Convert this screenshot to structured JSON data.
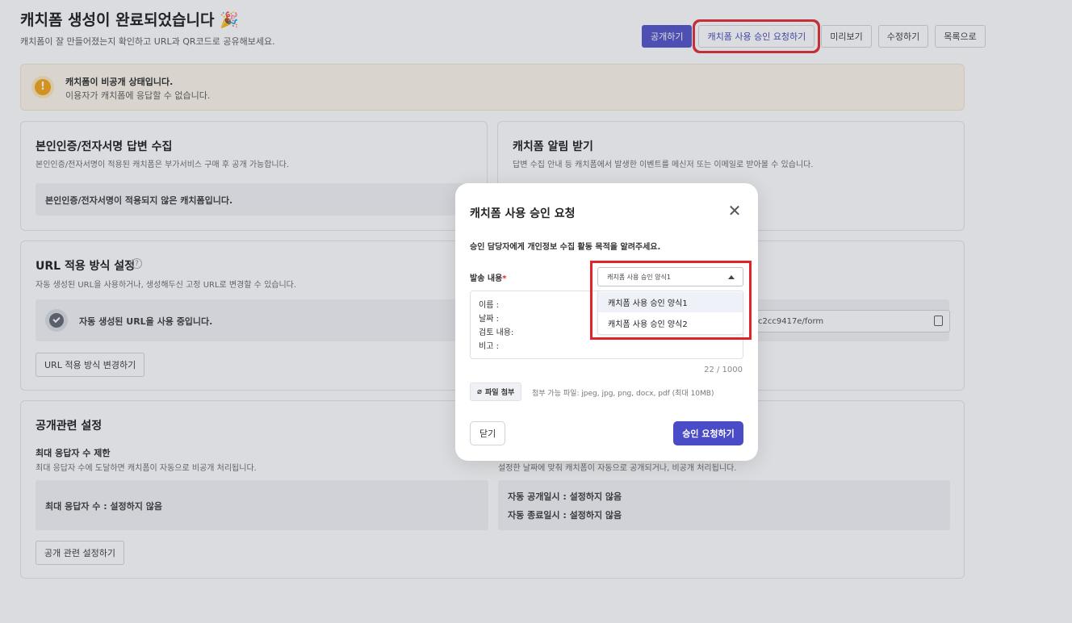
{
  "header": {
    "title": "캐치폼 생성이 완료되었습니다 🎉",
    "subtitle": "캐치폼이 잘 만들어졌는지 확인하고 URL과 QR코드로 공유해보세요."
  },
  "actions": {
    "publish": "공개하기",
    "request_approval": "캐치폼 사용 승인 요청하기",
    "preview": "미리보기",
    "edit": "수정하기",
    "list": "목록으로"
  },
  "notice": {
    "title": "캐치폼이 비공개 상태입니다.",
    "message": "이용자가 캐치폼에 응답할 수 없습니다."
  },
  "cards": {
    "auth": {
      "title": "본인인증/전자서명 답변 수집",
      "desc": "본인인증/전자서명이 적용된 캐치폼은 부가서비스 구매 후 공개 가능합니다.",
      "status": "본인인증/전자서명이 적용되지 않은 캐치폼입니다."
    },
    "alert": {
      "title": "캐치폼 알림 받기",
      "desc": "답변 수집 안내 등 캐치폼에서 발생한 이벤트를 메신저 또는 이메일로 받아볼 수 있습니다."
    },
    "url": {
      "title": "URL 적용 방식 설정",
      "desc": "자동 생성된 URL을 사용하거나, 생성해두신 고정 URL로 변경할 수 있습니다.",
      "status": "자동 생성된 URL을 사용 중입니다.",
      "change_button": "URL 적용 방식 변경하기",
      "url_value": "c2cc9417e/form"
    },
    "publish": {
      "title": "공개관련 설정",
      "max_title": "최대 응답자 수 제한",
      "max_desc": "최대 응답자 수에 도달하면 캐치폼이 자동으로 비공개 처리됩니다.",
      "max_value": "최대 응답자 수 : 설정하지 않음",
      "schedule_desc": "설정한 날짜에 맞춰 캐치폼이 자동으로 공개되거나, 비공개 처리됩니다.",
      "auto_open": "자동 공개일시 : 설정하지 않음",
      "auto_close": "자동 종료일시 : 설정하지 않음",
      "settings_button": "공개 관련 설정하기"
    }
  },
  "modal": {
    "title": "캐치폼 사용 승인 요청",
    "description": "승인 담당자에게 개인정보 수집 활동 목적을 알려주세요.",
    "field_label": "발송 내용",
    "required_mark": "*",
    "selected_template": "캐치폼 사용 승인 양식1",
    "options": [
      "캐치폼 사용 승인 양식1",
      "캐치폼 사용 승인 양식2"
    ],
    "content_lines": [
      "이름 :",
      "날짜 :",
      "검토 내용:",
      "비고 :"
    ],
    "counter": "22 / 1000",
    "attach_label": "파일 첨부",
    "attach_hint": "첨부 가능 파일: jpeg, jpg, png, docx, pdf (최대 10MB)",
    "close_label": "닫기",
    "submit_label": "승인 요청하기"
  },
  "colors": {
    "primary": "#4a4bc6",
    "highlight": "#e0242a",
    "warning": "#f2a10a"
  }
}
